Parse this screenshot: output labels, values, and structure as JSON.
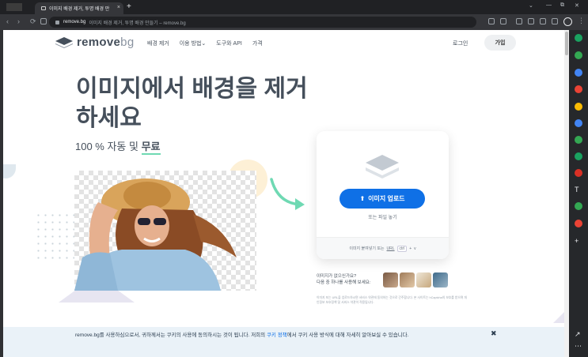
{
  "browser": {
    "tab_title": "이미지 배경 제거, 투명 배경 만",
    "tab_close": "×",
    "new_tab": "+",
    "url_domain": "remove.bg",
    "url_page_title": "이미지 배경 제거, 투명 배경 만들기 – remove.bg",
    "window_controls": [
      "⌄",
      "—",
      "⧉",
      "✕"
    ],
    "nav_back": "‹",
    "nav_forward": "›",
    "nav_reload": "⟳"
  },
  "nav": {
    "logo_main": "remove",
    "logo_suffix": "bg",
    "links": [
      "배경 제거",
      "이용 방법⌄",
      "도구와 API",
      "가격"
    ],
    "login": "로그인",
    "signup": "가입"
  },
  "hero": {
    "headline": "이미지에서 배경을 제거하세요",
    "sub_prefix": "100 % 자동 및 ",
    "sub_free": "무료"
  },
  "upload": {
    "button_label": "이미지 업로드",
    "drop_text": "또는 파일 놓기",
    "paste_text": "이미지 붙여넣기 또는",
    "paste_url": "URL",
    "shortcut_key": "ctrl",
    "shortcut_plus": "+",
    "shortcut_v": "v"
  },
  "samples": {
    "line1": "이미지가 없으신가요?",
    "line2": "다음 중 하나를 사용해 보세요:",
    "fineprint": "이미지 또는 URL을 업로드하시면 서비스 약관에 동의하는 것으로 간주합니다. 본 사이트는 hCaptcha의 보호를 받으며 개인정보 보호정책 및 서비스 약관이 적용됩니다."
  },
  "cookie": {
    "text_before": "remove.bg를 사용하심으로서, 귀하께서는 쿠키의 사용에 동의하시는 것이 됩니다. 저희의 ",
    "link": "쿠키 정책",
    "text_after": "에서 쿠키 사용 방식에 대해 자세히 알아보실 수 있습니다.",
    "close": "✖"
  },
  "colors": {
    "accent": "#0f70e6",
    "underline": "#6fd9b3",
    "arrow": "#6fd9b3"
  }
}
